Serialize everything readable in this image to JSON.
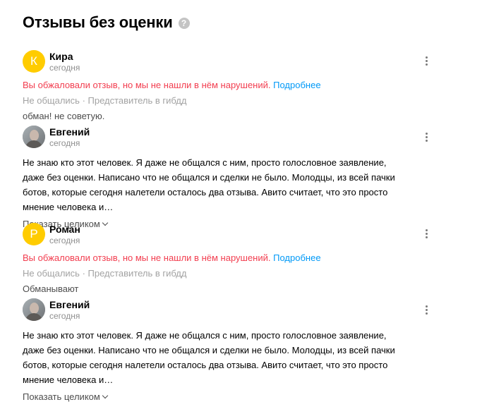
{
  "page": {
    "title": "Отзывы без оценки",
    "help_icon": "?"
  },
  "reviews": [
    {
      "avatar_letter": "К",
      "author": "Кира",
      "date": "сегодня",
      "appeal_text": "Вы обжаловали отзыв, но мы не нашли в нём нарушений.",
      "appeal_link": "Подробнее",
      "tags": "Не общались · Представитель в гибдд",
      "text": "обман! не советую.",
      "reply": {
        "author": "Евгений",
        "date": "сегодня",
        "text": "Не знаю кто этот человек. Я даже не общался с ним, просто голословное заявление, даже без оценки. Написано что не общался и сделки не было. Молодцы, из всей пачки ботов, которые сегодня налетели осталось два отзыва. Авито считает, что это просто мнение человека и…",
        "expand_label": "Показать целиком"
      }
    },
    {
      "avatar_letter": "Р",
      "author": "Роман",
      "date": "сегодня",
      "appeal_text": "Вы обжаловали отзыв, но мы не нашли в нём нарушений.",
      "appeal_link": "Подробнее",
      "tags": "Не общались · Представитель в гибдд",
      "text": "Обманывают",
      "reply": {
        "author": "Евгений",
        "date": "сегодня",
        "text": "Не знаю кто этот человек. Я даже не общался с ним, просто голословное заявление, даже без оценки. Написано что не общался и сделки не было. Молодцы, из всей пачки ботов, которые сегодня налетели осталось два отзыва. Авито считает, что это просто мнение человека и…",
        "expand_label": "Показать целиком"
      }
    }
  ],
  "colors": {
    "avatar_yellow": "#ffcc00",
    "appeal_red": "#f23d4f",
    "link_blue": "#0099f7"
  }
}
